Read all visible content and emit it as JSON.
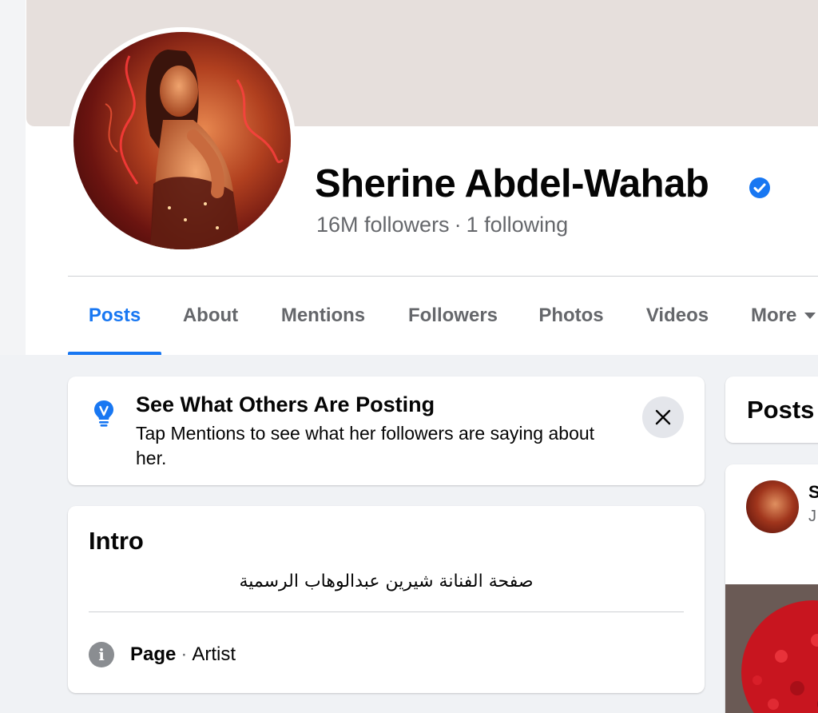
{
  "profile": {
    "name": "Sherine Abdel-Wahab",
    "followers": "16M followers",
    "dot": "·",
    "following": "1 following"
  },
  "tabs": [
    {
      "label": "Posts"
    },
    {
      "label": "About"
    },
    {
      "label": "Mentions"
    },
    {
      "label": "Followers"
    },
    {
      "label": "Photos"
    },
    {
      "label": "Videos"
    },
    {
      "label": "More"
    }
  ],
  "tip": {
    "title": "See What Others Are Posting",
    "body": "Tap Mentions to see what her followers are saying about her."
  },
  "intro": {
    "title": "Intro",
    "bio": "صفحة الفنانة شيرين عبدالوهاب الرسمية",
    "info_icon_text": "i",
    "page_label": "Page",
    "sep": "·",
    "category": "Artist"
  },
  "posts_section": {
    "title": "Posts"
  },
  "post": {
    "author_partial": "S",
    "date_partial": "J"
  },
  "icons": {
    "verified": "verified-badge-icon",
    "tip": "lightbulb-icon",
    "close": "close-icon",
    "info": "info-icon",
    "caret": "caret-down-icon"
  },
  "colors": {
    "accent": "#1877f2",
    "secondary_text": "#65676b",
    "background": "#f0f2f5",
    "cover": "#e6dfdc"
  }
}
